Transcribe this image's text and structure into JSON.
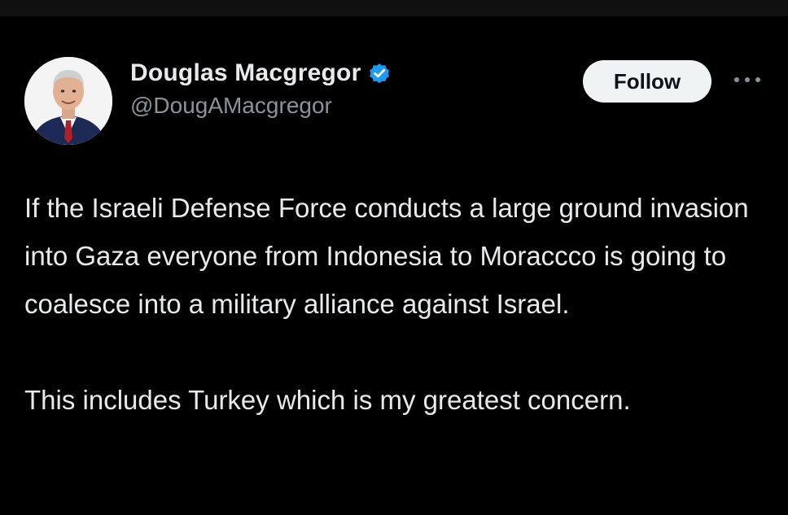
{
  "tweet": {
    "author": {
      "display_name": "Douglas Macgregor",
      "handle": "@DougAMacgregor",
      "verified": true,
      "verified_color": "#1d9bf0"
    },
    "follow_label": "Follow",
    "more_icon": "more-dots-icon",
    "paragraphs": [
      "If the Israeli Defense Force conducts a large ground invasion into Gaza everyone from Indonesia to Moraccco is going to coalesce into a military alliance against Israel.",
      "This includes Turkey which is my greatest concern."
    ]
  }
}
